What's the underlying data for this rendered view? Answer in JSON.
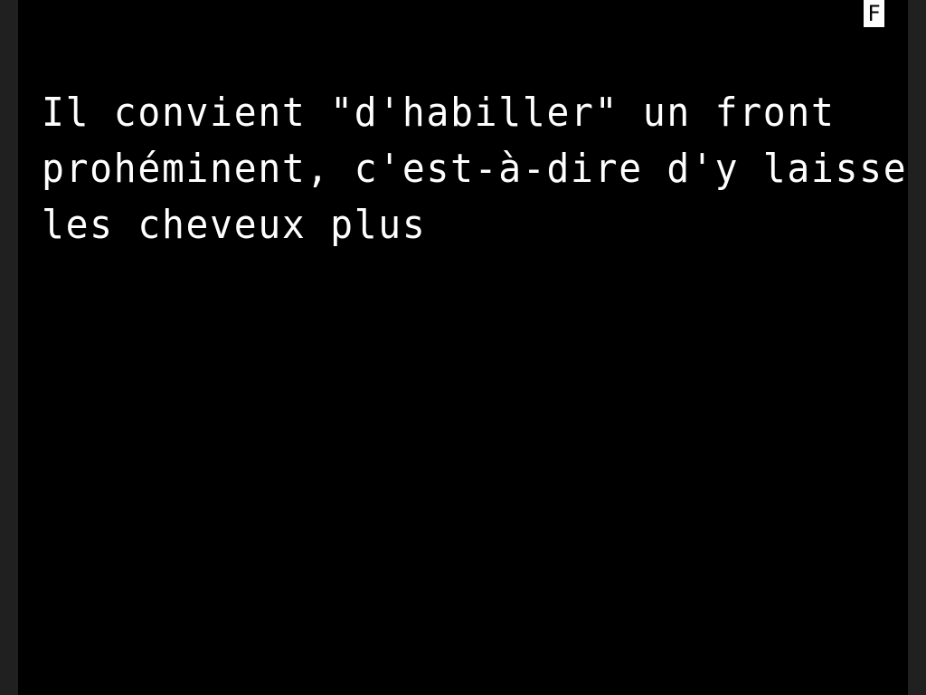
{
  "status": {
    "indicator": "F"
  },
  "page": {
    "lines": [
      "Il convient \"d'habiller\" un front",
      "prohéminent, c'est-à-dire d'y laisser",
      "les cheveux plus"
    ]
  },
  "colors": {
    "background": "#000000",
    "text": "#ffffff",
    "frame": "#202020"
  }
}
